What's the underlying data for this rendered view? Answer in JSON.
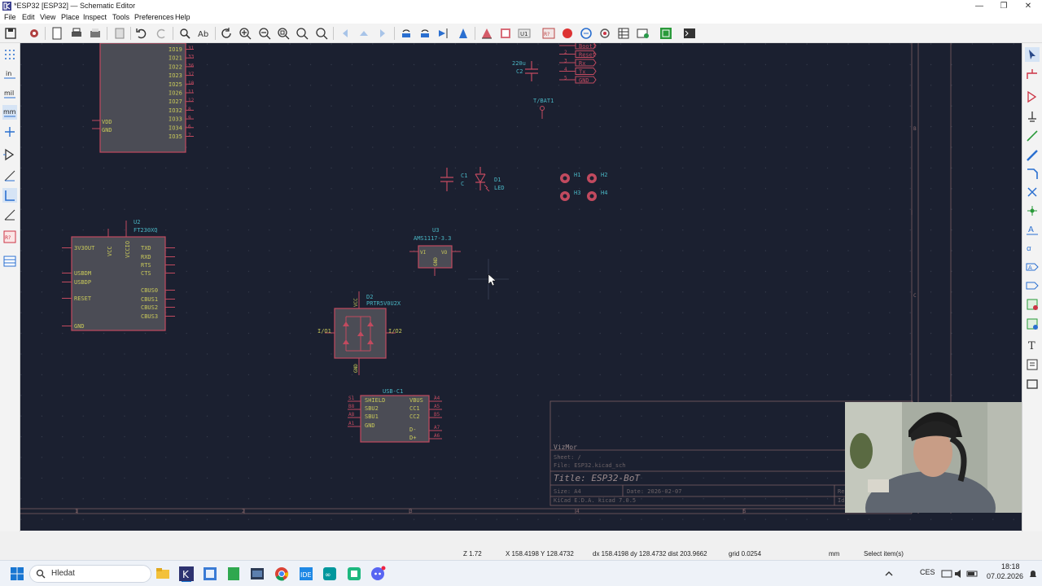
{
  "window": {
    "title": "*ESP32 [ESP32] — Schematic Editor"
  },
  "menu": [
    "File",
    "Edit",
    "View",
    "Place",
    "Inspect",
    "Tools",
    "Preferences",
    "Help"
  ],
  "unit_buttons": [
    "in",
    "mil",
    "mm"
  ],
  "schematic": {
    "u1_pins": [
      "IO19",
      "IO21",
      "IO22",
      "IO23",
      "IO25",
      "IO26",
      "IO27",
      "IO32",
      "IO33",
      "IO34",
      "IO35"
    ],
    "u1_pin_numbers": [
      "31",
      "33",
      "36",
      "37",
      "10",
      "11",
      "12",
      "8",
      "9",
      "6",
      "7"
    ],
    "u1_power_labels": [
      "VDD",
      "GND"
    ],
    "u2": {
      "ref": "U2",
      "value": "FT230XQ",
      "left_pins": [
        "3V3OUT",
        "USBDM",
        "USBDP",
        "RESET",
        "GND"
      ],
      "top_pins": [
        "VCC",
        "VCCIO"
      ],
      "right_pins": [
        "TXD",
        "RXD",
        "RTS",
        "CTS",
        "CBUS0",
        "CBUS1",
        "CBUS2",
        "CBUS3"
      ]
    },
    "u3": {
      "ref": "U3",
      "value": "AMS1117-3.3",
      "pins": [
        "VI",
        "VO",
        "GND"
      ]
    },
    "c1": {
      "ref": "C1",
      "value": "C"
    },
    "d1": {
      "ref": "D1",
      "value": "LED"
    },
    "c2": {
      "ref": "C2",
      "value": "220u"
    },
    "bat": {
      "ref": "T/BAT1"
    },
    "holes": [
      "H1",
      "H2",
      "H3",
      "H4"
    ],
    "d2": {
      "ref": "D2",
      "value": "PRTR5V0U2X",
      "pins": [
        "I/O1",
        "I/O2",
        "VCC",
        "GND"
      ]
    },
    "usb": {
      "ref": "USB-C1",
      "left_pins": [
        "SHIELD",
        "SBU2",
        "SBU1",
        "GND"
      ],
      "right_pins": [
        "VBUS",
        "CC1",
        "CC2",
        "D-",
        "D+"
      ],
      "left_nums": [
        "S1",
        "B8",
        "A8",
        "A1"
      ],
      "right_nums": [
        "A4",
        "A5",
        "B5",
        "A7",
        "A6"
      ]
    },
    "header_pins": [
      "Boot1",
      "Reset",
      "Rx",
      "Tx",
      "GND"
    ],
    "header_nums": [
      "2",
      "3",
      "4",
      "5"
    ],
    "title_block": {
      "company": "VizMor",
      "sheet": "Sheet: /",
      "file": "File: ESP32.kicad_sch",
      "title": "Title: ESP32-BoT",
      "size": "Size: A4",
      "date": "Date: 2026-02-07",
      "kicad": "KiCad E.D.A.  kicad 7.0.5",
      "rev": "Re",
      "id": "Id"
    },
    "frame_cols": [
      "1",
      "2",
      "3",
      "4",
      "5"
    ],
    "frame_rows": [
      "B",
      "C"
    ]
  },
  "status": {
    "zoom": "Z 1.72",
    "cursor": "X 158.4198  Y 128.4732",
    "delta": "dx 158.4198  dy 128.4732  dist 203.9662",
    "grid": "grid 0.0254",
    "units": "mm",
    "mode": "Select item(s)"
  },
  "taskbar": {
    "search": "Hledat",
    "lang": "CES",
    "time": "18:18",
    "date": "07.02.2026"
  },
  "colors": {
    "canvas": "#1b2030",
    "symbol_body": "#4b4c55",
    "symbol_outline": "#c24a5f",
    "pin_text": "#c8c85a",
    "field_text": "#49b4c2",
    "wire": "#c24a5f"
  }
}
